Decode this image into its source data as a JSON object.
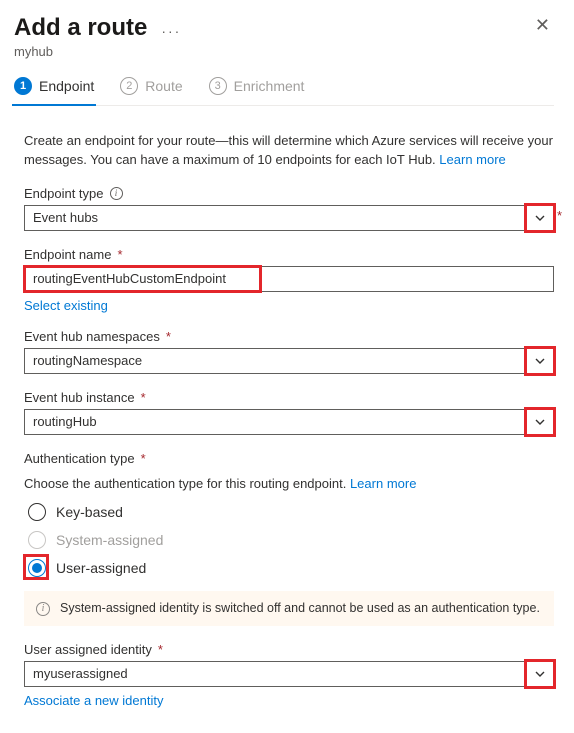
{
  "header": {
    "title": "Add a route",
    "subtitle": "myhub"
  },
  "steps": [
    {
      "num": "1",
      "label": "Endpoint",
      "active": true
    },
    {
      "num": "2",
      "label": "Route",
      "active": false
    },
    {
      "num": "3",
      "label": "Enrichment",
      "active": false
    }
  ],
  "intro": {
    "text": "Create an endpoint for your route—this will determine which Azure services will receive your messages. You can have a maximum of 10 endpoints for each IoT Hub. ",
    "learn_more": "Learn more"
  },
  "fields": {
    "endpoint_type": {
      "label": "Endpoint type",
      "value": "Event hubs"
    },
    "endpoint_name": {
      "label": "Endpoint name",
      "value": "routingEventHubCustomEndpoint",
      "select_existing": "Select existing"
    },
    "namespaces": {
      "label": "Event hub namespaces",
      "value": "routingNamespace"
    },
    "instance": {
      "label": "Event hub instance",
      "value": "routingHub"
    },
    "auth_type": {
      "label": "Authentication type",
      "desc": "Choose the authentication type for this routing endpoint. ",
      "learn_more": "Learn more",
      "options": {
        "key": "Key-based",
        "system": "System-assigned",
        "user": "User-assigned"
      }
    },
    "banner": "System-assigned identity is switched off and cannot be used as an authentication type.",
    "user_identity": {
      "label": "User assigned identity",
      "value": "myuserassigned",
      "associate": "Associate a new identity"
    }
  }
}
